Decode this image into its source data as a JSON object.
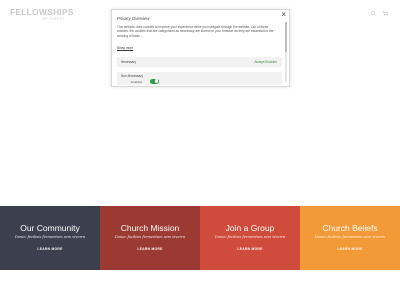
{
  "site": {
    "logo_text": "FELLOWSHIPS",
    "logo_sub": "OF CHRIST",
    "icons": [
      "search-icon",
      "cart-icon"
    ]
  },
  "privacy_modal": {
    "close_label": "×",
    "title": "Privacy Overview",
    "body": "This website uses cookies to improve your experience while you navigate through the website. Out of these cookies, the cookies that are categorized as necessary are stored on your browser as they are essential for the working of basic...",
    "more_label": "Show more",
    "rows": [
      {
        "label": "Necessary",
        "status": "Always Enabled"
      },
      {
        "label": "Non-Necessary",
        "toggle_label": "Enabled",
        "toggle_on": true
      }
    ]
  },
  "tiles": [
    {
      "title": "Our Community",
      "subtitle": "Donec facilisis fermentum sem viverra",
      "link": "LEARN MORE",
      "color": "#3c3f4e"
    },
    {
      "title": "Church Mission",
      "subtitle": "Donec facilisis fermentum sem viverra",
      "link": "LEARN MORE",
      "color": "#9b3a33"
    },
    {
      "title": "Join a Group",
      "subtitle": "Donec facilisis fermentum sem viverra",
      "link": "LEARN MORE",
      "color": "#cf4b3c"
    },
    {
      "title": "Church Beliefs",
      "subtitle": "Donec facilisis fermentum sem viverra",
      "link": "LEARN MORE",
      "color": "#f39a38"
    }
  ]
}
